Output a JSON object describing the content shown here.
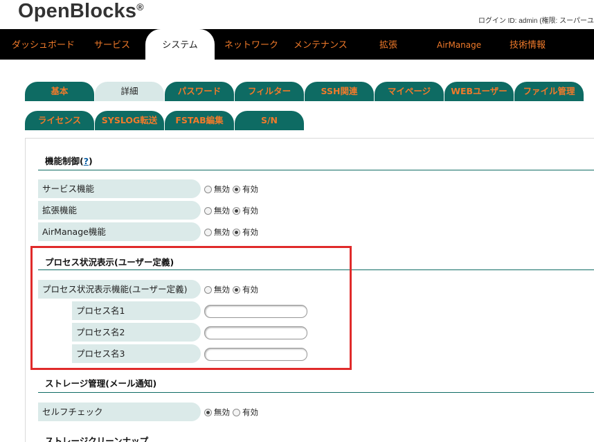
{
  "header": {
    "logo": "OpenBlocks",
    "logo_mark": "®",
    "login_info": "ログイン ID: admin (権限: スーパーユ"
  },
  "topnav": {
    "items": [
      {
        "label": "ダッシュボード"
      },
      {
        "label": "サービス"
      },
      {
        "label": "システム"
      },
      {
        "label": "ネットワーク"
      },
      {
        "label": "メンテナンス"
      },
      {
        "label": "拡張"
      },
      {
        "label": "AirManage"
      },
      {
        "label": "技術情報"
      }
    ]
  },
  "tabs_row1": [
    {
      "label": "基本"
    },
    {
      "label": "詳細"
    },
    {
      "label": "パスワード"
    },
    {
      "label": "フィルター"
    },
    {
      "label": "SSH関連"
    },
    {
      "label": "マイページ"
    },
    {
      "label": "WEBユーザー"
    },
    {
      "label": "ファイル管理"
    }
  ],
  "tabs_row2": [
    {
      "label": "ライセンス"
    },
    {
      "label": "SYSLOG転送"
    },
    {
      "label": "FSTAB編集"
    },
    {
      "label": "S/N"
    }
  ],
  "sections": {
    "func_control": {
      "title": "機能制御(",
      "help": "?",
      "title_end": ")",
      "rows": [
        {
          "label": "サービス機能",
          "off": "無効",
          "on": "有効",
          "selected": "on"
        },
        {
          "label": "拡張機能",
          "off": "無効",
          "on": "有効",
          "selected": "on"
        },
        {
          "label": "AirManage機能",
          "off": "無効",
          "on": "有効",
          "selected": "on"
        }
      ]
    },
    "process": {
      "title": "プロセス状況表示(ユーザー定義)",
      "toggle": {
        "label": "プロセス状況表示機能(ユーザー定義)",
        "off": "無効",
        "on": "有効",
        "selected": "on"
      },
      "fields": [
        {
          "label": "プロセス名1",
          "value": ""
        },
        {
          "label": "プロセス名2",
          "value": ""
        },
        {
          "label": "プロセス名3",
          "value": ""
        }
      ]
    },
    "storage": {
      "title": "ストレージ管理(メール通知)",
      "rows": [
        {
          "label": "セルフチェック",
          "off": "無効",
          "on": "有効",
          "selected": "off"
        }
      ]
    },
    "storage_cleanup": {
      "title": "ストレージクリーンナップ"
    }
  },
  "colors": {
    "accent": "#f07a2a",
    "tab_bg": "#0e6b63",
    "label_bg": "#dbeae9",
    "highlight": "#e02a2a"
  }
}
